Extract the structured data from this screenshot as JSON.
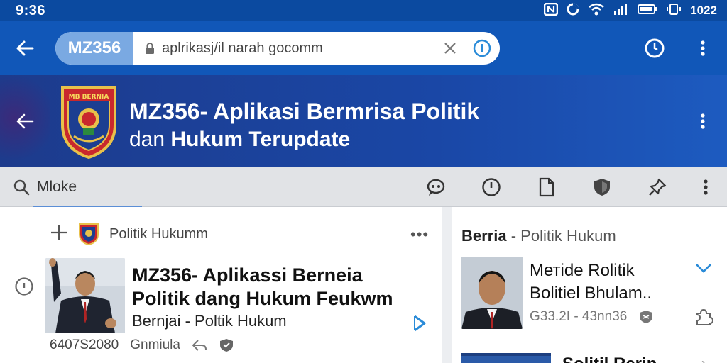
{
  "status_bar": {
    "time": "9:36",
    "right_text": "1022",
    "icons": [
      "nfc-icon",
      "data-saver-icon",
      "wifi-icon",
      "signal-icon",
      "battery-icon",
      "vibrate-icon"
    ]
  },
  "browser": {
    "site_chip": "MZ356",
    "url": "aplrikasj/il narah gocomm",
    "icons": [
      "back-arrow-icon",
      "lock-icon",
      "clear-icon",
      "info-icon",
      "timer-icon",
      "more-vert-icon"
    ]
  },
  "app_header": {
    "title": "MZ356- Aplikasi Bermrisa Politik",
    "subtitle_prefix": "dan",
    "subtitle_bold": "Hukum Terupdate",
    "crest_text": "MB BERNIA"
  },
  "toolbar": {
    "search_text": "Mloke",
    "icons": [
      "chat-icon",
      "clock-icon",
      "document-icon",
      "shield-icon",
      "pin-icon",
      "more-vert-icon"
    ]
  },
  "main_article": {
    "category": "Politik Hukumm",
    "title_line1": "MZ356- Aplikassi Berneia",
    "title_line2": "Politik dang Hukum Feukwm",
    "category_line": "Bernjai - Poltik Hukum",
    "date": "6407S2080",
    "source": "Gnmiula"
  },
  "side_panel": {
    "heading_bold": "Berria",
    "heading_rest": "- Politik Hukum",
    "item1_title_line1": "Mетide Rolitik",
    "item1_title_line2": "Bolitiel Bhulam..",
    "item1_meta": "G33.2I - 43nn36",
    "item2_title": "Solitil Rerin"
  },
  "colors": {
    "statusbar": "#0b4aa0",
    "urlbar": "#1157b8",
    "header": "#1a47a6",
    "accent": "#2a8bd8"
  }
}
